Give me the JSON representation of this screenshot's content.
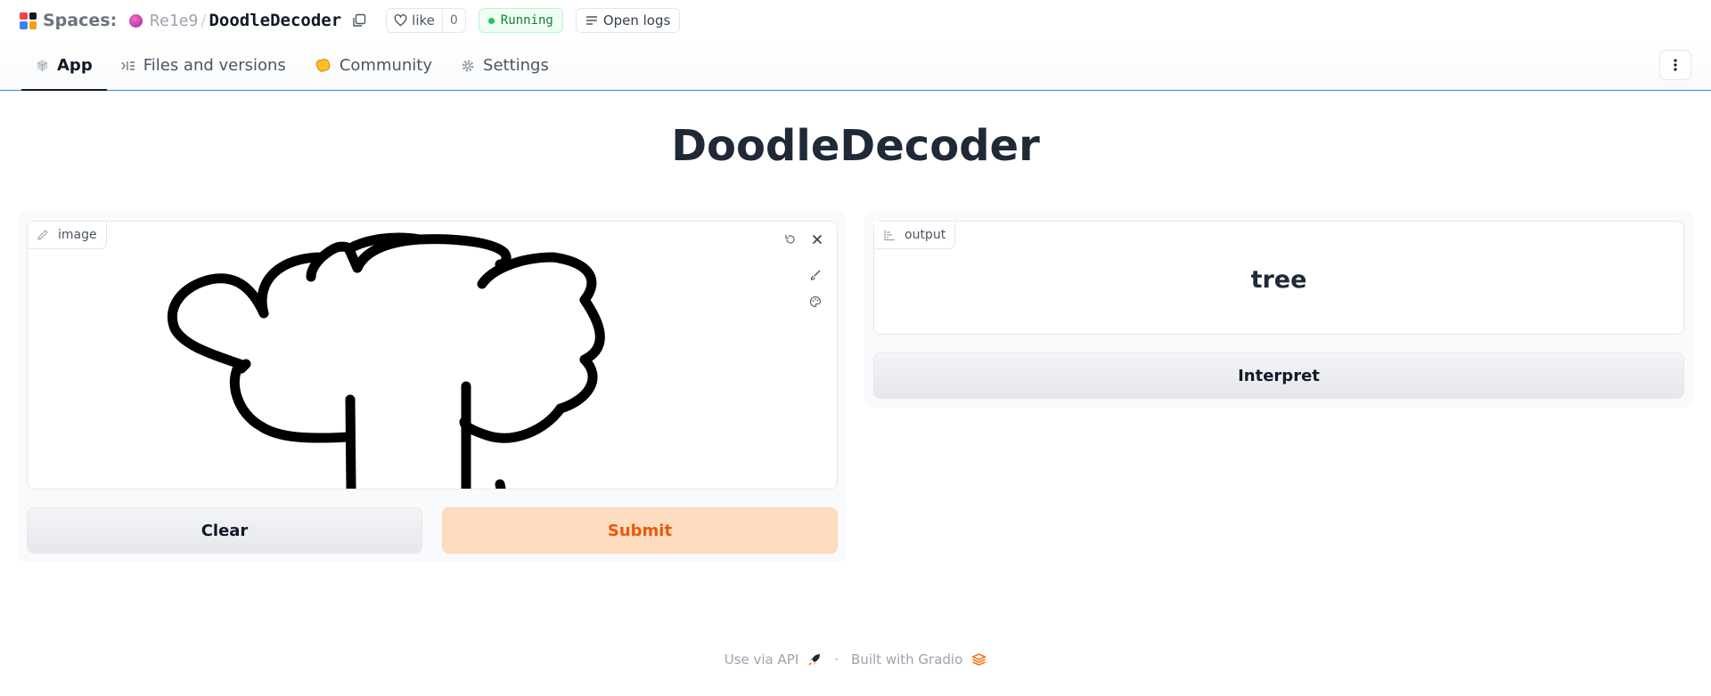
{
  "header": {
    "spaces_label": "Spaces:",
    "owner": "Re1e9",
    "separator": "/",
    "repo": "DoodleDecoder",
    "like_label": "like",
    "like_count": "0",
    "status": "Running",
    "logs_label": "Open logs"
  },
  "tabs": [
    {
      "label": "App",
      "icon": "app-cube-icon",
      "active": true
    },
    {
      "label": "Files and versions",
      "icon": "files-icon",
      "active": false
    },
    {
      "label": "Community",
      "icon": "community-icon",
      "active": false
    },
    {
      "label": "Settings",
      "icon": "gear-icon",
      "active": false
    }
  ],
  "app": {
    "title": "DoodleDecoder",
    "input": {
      "label": "image"
    },
    "buttons": {
      "clear": "Clear",
      "submit": "Submit",
      "interpret": "Interpret"
    },
    "output": {
      "label": "output",
      "value": "tree"
    }
  },
  "footer": {
    "api_label": "Use via API",
    "separator": "·",
    "built_label": "Built with Gradio"
  },
  "colors": {
    "accent_blue": "#3b82f6",
    "submit_bg": "#fedcc0",
    "submit_text": "#ea580c",
    "running_green": "#15803d"
  }
}
